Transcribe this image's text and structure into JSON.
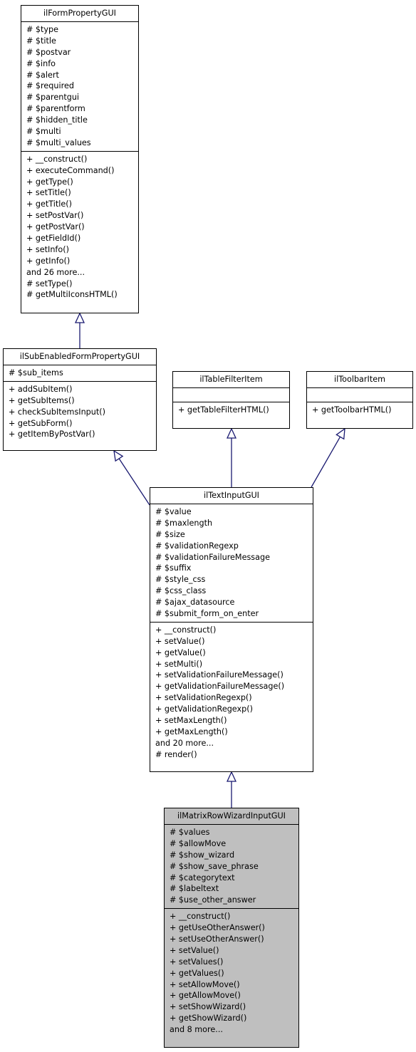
{
  "classes": {
    "ilFormPropertyGUI": {
      "name": "ilFormPropertyGUI",
      "attributes": [
        "# $type",
        "# $title",
        "# $postvar",
        "# $info",
        "# $alert",
        "# $required",
        "# $parentgui",
        "# $parentform",
        "# $hidden_title",
        "# $multi",
        "# $multi_values"
      ],
      "methods": [
        "+ __construct()",
        "+ executeCommand()",
        "+ getType()",
        "+ setTitle()",
        "+ getTitle()",
        "+ setPostVar()",
        "+ getPostVar()",
        "+ getFieldId()",
        "+ setInfo()",
        "+ getInfo()",
        "and 26 more...",
        "# setType()",
        "# getMultiIconsHTML()"
      ]
    },
    "ilSubEnabledFormPropertyGUI": {
      "name": "ilSubEnabledFormPropertyGUI",
      "attributes": [
        "# $sub_items"
      ],
      "methods": [
        "+ addSubItem()",
        "+ getSubItems()",
        "+ checkSubItemsInput()",
        "+ getSubForm()",
        "+ getItemByPostVar()"
      ]
    },
    "ilTableFilterItem": {
      "name": "ilTableFilterItem",
      "attributes": [],
      "methods": [
        "+ getTableFilterHTML()"
      ]
    },
    "ilToolbarItem": {
      "name": "ilToolbarItem",
      "attributes": [],
      "methods": [
        "+ getToolbarHTML()"
      ]
    },
    "ilTextInputGUI": {
      "name": "ilTextInputGUI",
      "attributes": [
        "# $value",
        "# $maxlength",
        "# $size",
        "# $validationRegexp",
        "# $validationFailureMessage",
        "# $suffix",
        "# $style_css",
        "# $css_class",
        "# $ajax_datasource",
        "# $submit_form_on_enter"
      ],
      "methods": [
        "+ __construct()",
        "+ setValue()",
        "+ getValue()",
        "+ setMulti()",
        "+ setValidationFailureMessage()",
        "+ getValidationFailureMessage()",
        "+ setValidationRegexp()",
        "+ getValidationRegexp()",
        "+ setMaxLength()",
        "+ getMaxLength()",
        "and 20 more...",
        "# render()"
      ]
    },
    "ilMatrixRowWizardInputGUI": {
      "name": "ilMatrixRowWizardInputGUI",
      "attributes": [
        "# $values",
        "# $allowMove",
        "# $show_wizard",
        "# $show_save_phrase",
        "# $categorytext",
        "# $labeltext",
        "# $use_other_answer"
      ],
      "methods": [
        "+ __construct()",
        "+ getUseOtherAnswer()",
        "+ setUseOtherAnswer()",
        "+ setValue()",
        "+ setValues()",
        "+ getValues()",
        "+ setAllowMove()",
        "+ getAllowMove()",
        "+ setShowWizard()",
        "+ getShowWizard()",
        "and 8 more..."
      ]
    }
  },
  "edges": [
    {
      "from": "ilSubEnabledFormPropertyGUI",
      "to": "ilFormPropertyGUI",
      "type": "inheritance"
    },
    {
      "from": "ilTextInputGUI",
      "to": "ilSubEnabledFormPropertyGUI",
      "type": "inheritance"
    },
    {
      "from": "ilTextInputGUI",
      "to": "ilTableFilterItem",
      "type": "inheritance"
    },
    {
      "from": "ilTextInputGUI",
      "to": "ilToolbarItem",
      "type": "inheritance"
    },
    {
      "from": "ilMatrixRowWizardInputGUI",
      "to": "ilTextInputGUI",
      "type": "inheritance"
    }
  ],
  "colors": {
    "edge": "#191970",
    "focus_fill": "#bfbfbf",
    "box_fill": "#ffffff"
  }
}
